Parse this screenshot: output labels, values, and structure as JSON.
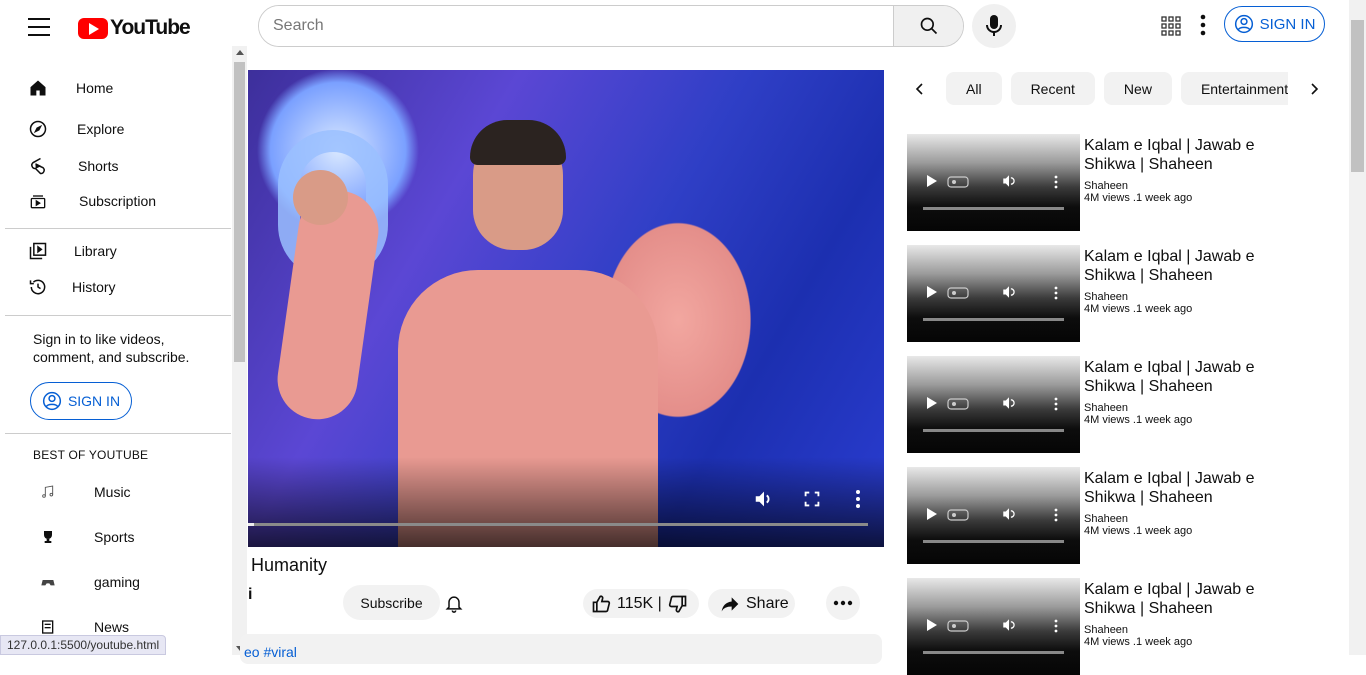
{
  "header": {
    "logo_text": "YouTube",
    "search_placeholder": "Search",
    "signin_label": "SIGN IN"
  },
  "sidebar": {
    "items": [
      {
        "label": "Home",
        "icon": "home-icon"
      },
      {
        "label": "Explore",
        "icon": "compass-icon"
      },
      {
        "label": "Shorts",
        "icon": "shorts-icon"
      },
      {
        "label": "Subscription",
        "icon": "subscription-icon"
      },
      {
        "label": "Library",
        "icon": "library-icon"
      },
      {
        "label": "History",
        "icon": "history-icon"
      }
    ],
    "signin_prompt": "Sign in to like videos, comment, and subscribe.",
    "signin_label": "SIGN IN",
    "best_heading": "BEST OF YOUTUBE",
    "best_items": [
      {
        "label": "Music",
        "icon": "music-icon"
      },
      {
        "label": "Sports",
        "icon": "trophy-icon"
      },
      {
        "label": "gaming",
        "icon": "gamepad-icon"
      },
      {
        "label": "News",
        "icon": "news-icon"
      }
    ]
  },
  "video": {
    "progress_fraction": 0.01,
    "title_visible": "Humanity",
    "channel_visible": "i",
    "subscribe_label": "Subscribe",
    "like_count": "115K |",
    "share_label": "Share",
    "description_visible": "eo #viral"
  },
  "chips": [
    "All",
    "Recent",
    "New",
    "Entertainment"
  ],
  "recommendations": [
    {
      "title": "Kalam e Iqbal | Jawab e Shikwa | Shaheen",
      "channel": "Shaheen",
      "meta": "4M views .1 week ago"
    },
    {
      "title": "Kalam e Iqbal | Jawab e Shikwa | Shaheen",
      "channel": "Shaheen",
      "meta": "4M views .1 week ago"
    },
    {
      "title": "Kalam e Iqbal | Jawab e Shikwa | Shaheen",
      "channel": "Shaheen",
      "meta": "4M views .1 week ago"
    },
    {
      "title": "Kalam e Iqbal | Jawab e Shikwa | Shaheen",
      "channel": "Shaheen",
      "meta": "4M views .1 week ago"
    },
    {
      "title": "Kalam e Iqbal | Jawab e Shikwa | Shaheen",
      "channel": "Shaheen",
      "meta": "4M views .1 week ago"
    }
  ],
  "statusbar": {
    "url": "127.0.0.1:5500/youtube.html"
  },
  "colors": {
    "brand": "#ff0000",
    "link": "#065fd4",
    "chip_bg": "#f2f2f2"
  }
}
